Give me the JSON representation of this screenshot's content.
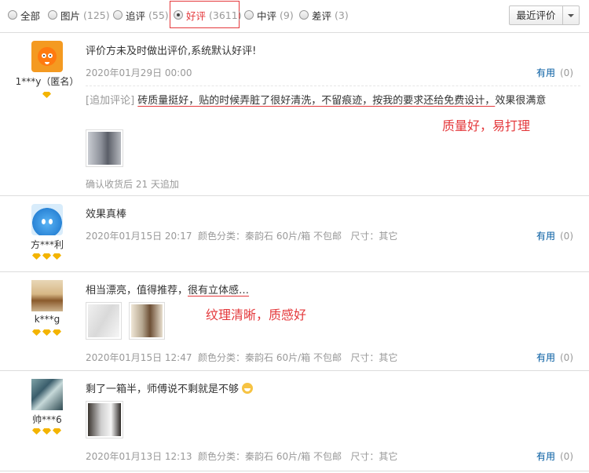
{
  "filters": [
    {
      "label": "全部",
      "count": "",
      "checked": false
    },
    {
      "label": "图片",
      "count": "(125)",
      "checked": false
    },
    {
      "label": "追评",
      "count": "(55)",
      "checked": false
    },
    {
      "label": "好评",
      "count": "(3611)",
      "checked": true
    },
    {
      "label": "中评",
      "count": "(9)",
      "checked": false
    },
    {
      "label": "差评",
      "count": "(3)",
      "checked": false
    }
  ],
  "sort": {
    "label": "最近评价"
  },
  "accent_color": "#e4393c",
  "link_color": "#005aa0",
  "reviews": [
    {
      "avatar_icon": "orange-mascot-avatar",
      "nickname": "1***y（匿名）",
      "diamonds": 1,
      "text": "评价方未及时做出评价,系统默认好评!",
      "date": "2020年01月29日 00:00",
      "useful_label": "有用",
      "useful_count": "(0)",
      "append_tag": "[追加评论]",
      "append_text": "砖质量挺好，贴的时候弄脏了很好清洗，不留痕迹，按我的要求还给免费设计，",
      "append_rest": "效果很满意",
      "annotation": "质量好，易打理",
      "append_note": "确认收货后 21 天追加"
    },
    {
      "avatar_icon": "blue-drop-avatar",
      "nickname": "方***利",
      "diamonds": 3,
      "text": "效果真棒",
      "date": "2020年01月15日 20:17",
      "spec": "颜色分类：秦韵石 60片/箱 不包邮   尺寸：其它",
      "useful_label": "有用",
      "useful_count": "(0)"
    },
    {
      "avatar_icon": "photo-avatar",
      "nickname": "k***g",
      "diamonds": 3,
      "text": "相当漂亮，值得推荐，",
      "text_highlight": "很有立体感…",
      "annotation": "纹理清晰，质感好",
      "date": "2020年01月15日 12:47",
      "spec": "颜色分类：秦韵石 60片/箱 不包邮   尺寸：其它",
      "useful_label": "有用",
      "useful_count": "(0)"
    },
    {
      "avatar_icon": "photo-avatar",
      "nickname": "帅***6",
      "diamonds": 3,
      "text": "剩了一箱半，师傅说不剩就是不够",
      "date": "2020年01月13日 12:13",
      "spec": "颜色分类：秦韵石 60片/箱 不包邮   尺寸：其它",
      "useful_label": "有用",
      "useful_count": "(0)"
    }
  ]
}
